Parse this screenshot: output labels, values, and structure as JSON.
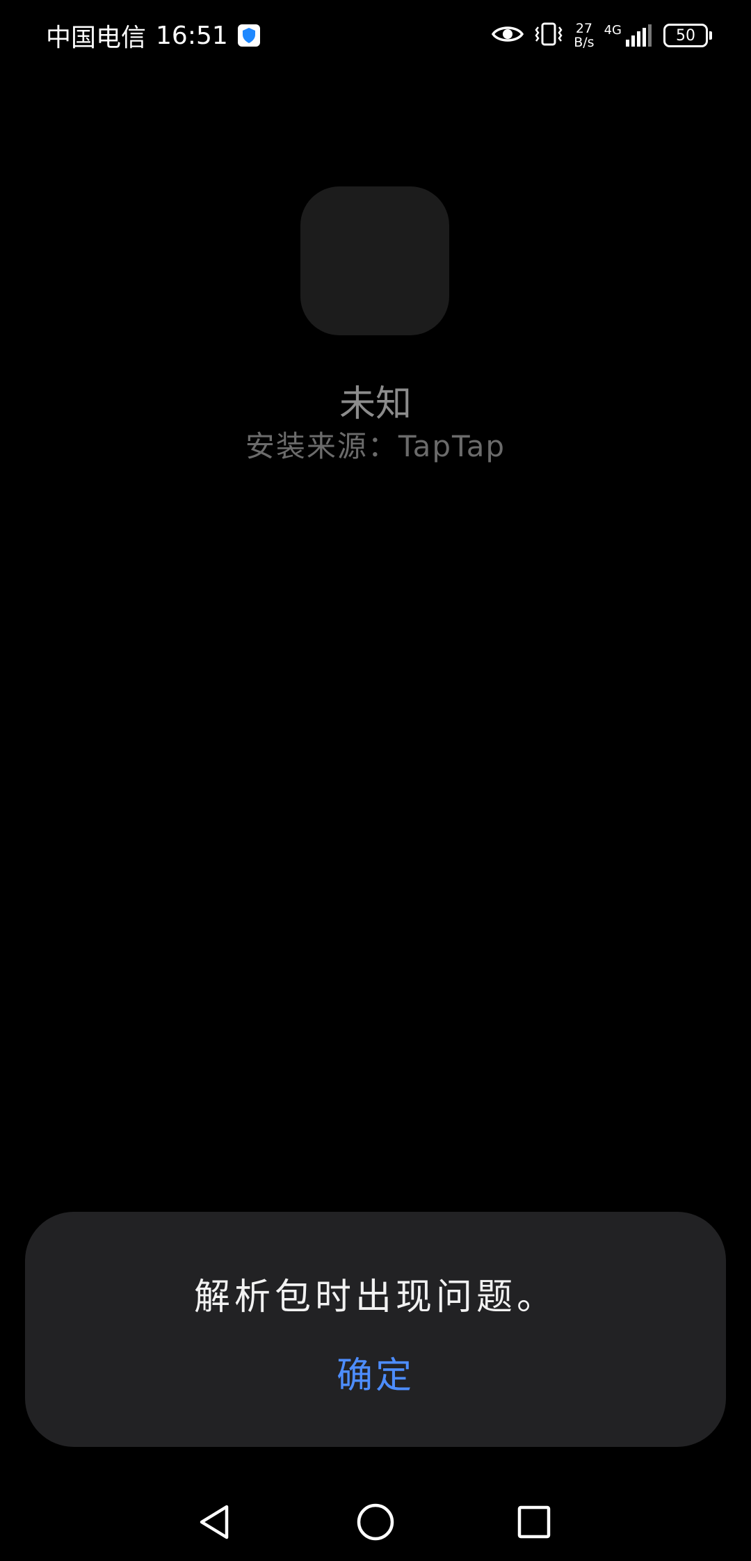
{
  "status_bar": {
    "carrier": "中国电信",
    "time": "16:51",
    "net_speed_value": "27",
    "net_speed_unit": "B/s",
    "network_type": "4G",
    "battery_level": "50"
  },
  "app": {
    "name": "未知",
    "install_source": "安装来源：TapTap"
  },
  "dialog": {
    "message": "解析包时出现问题。",
    "ok_label": "确定"
  },
  "colors": {
    "background": "#000000",
    "dialog_bg": "#222224",
    "accent": "#4d8dff",
    "icon_placeholder": "#1c1c1c"
  },
  "icons": {
    "shield": "shield-icon",
    "eye": "eye-icon",
    "vibrate": "vibrate-icon",
    "signal": "signal-icon",
    "battery": "battery-icon",
    "back": "back-icon",
    "home": "home-icon",
    "recents": "recents-icon"
  }
}
